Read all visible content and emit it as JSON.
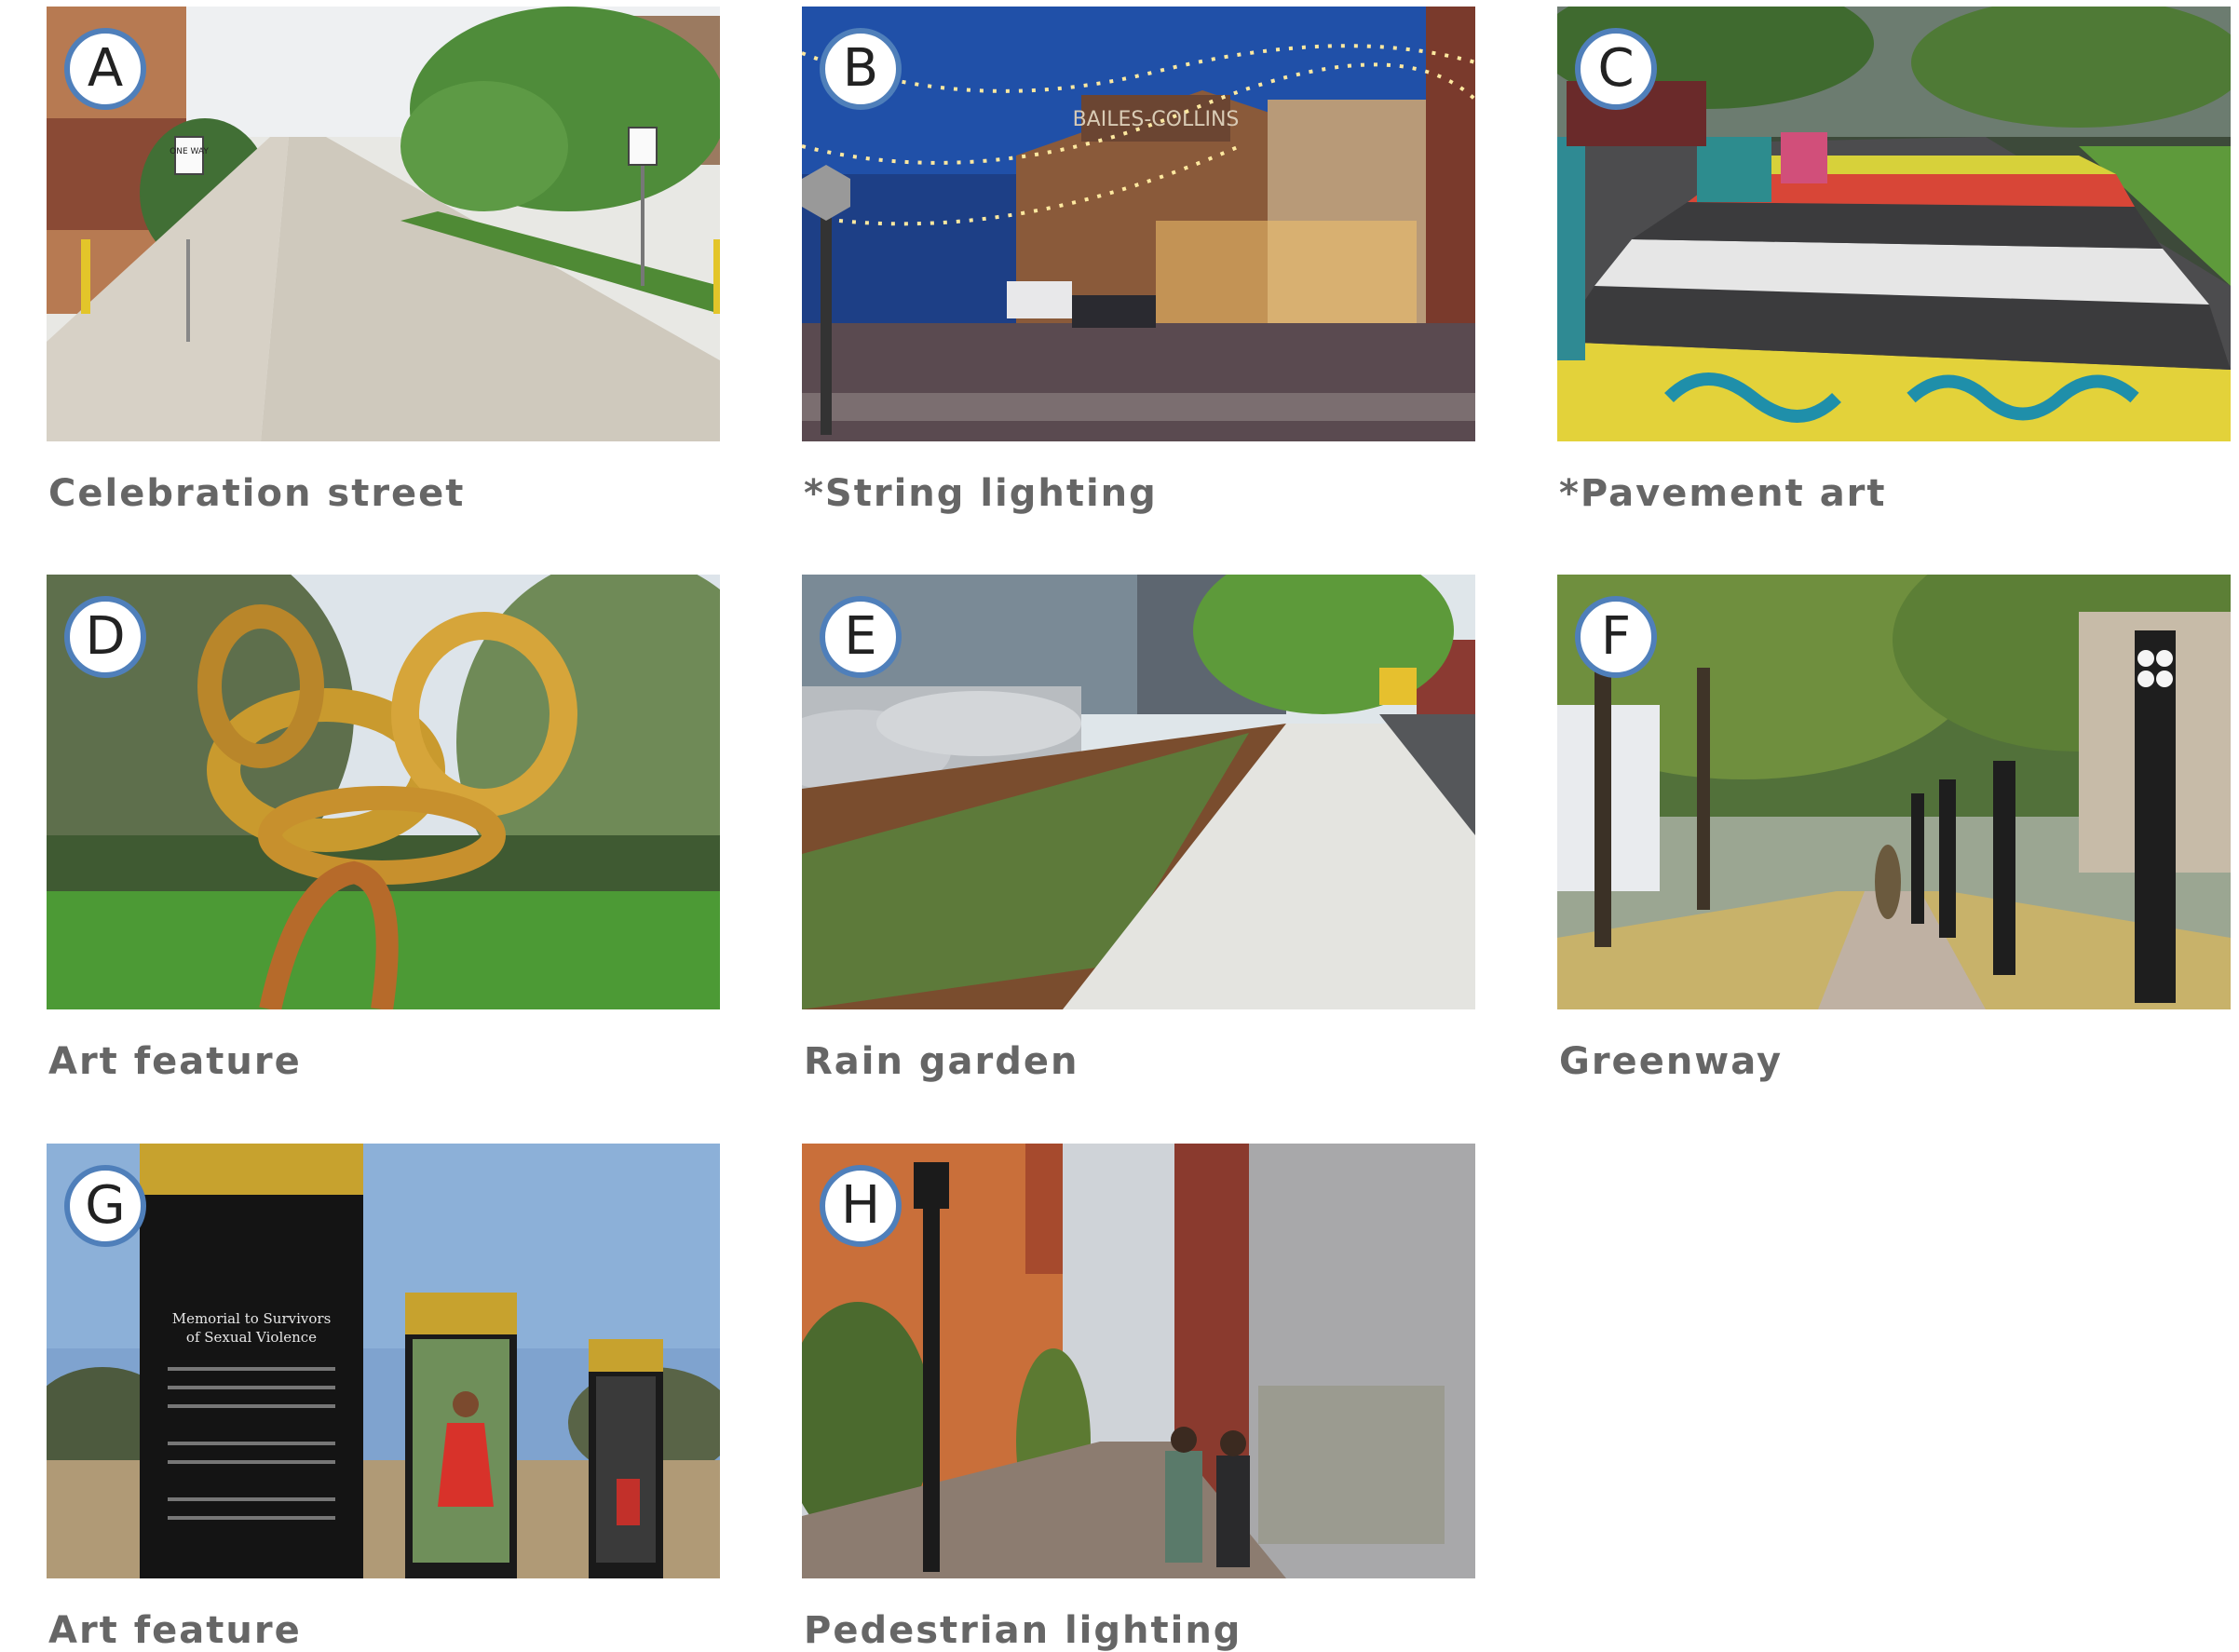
{
  "cards": [
    {
      "letter": "A",
      "caption": "Celebration street"
    },
    {
      "letter": "B",
      "caption": "*String lighting"
    },
    {
      "letter": "C",
      "caption": "*Pavement art"
    },
    {
      "letter": "D",
      "caption": "Art feature"
    },
    {
      "letter": "E",
      "caption": "Rain garden"
    },
    {
      "letter": "F",
      "caption": "Greenway"
    },
    {
      "letter": "G",
      "caption": "Art feature"
    },
    {
      "letter": "H",
      "caption": "Pedestrian lighting"
    }
  ],
  "photo_text": {
    "sign_one_way": "ONE WAY",
    "building_sign": "BAILES-COLLINS",
    "memorial_title_1": "Memorial to Survivors",
    "memorial_title_2": "of Sexual Violence"
  },
  "colors": {
    "badge_border": "#4f7fba",
    "caption": "#666666"
  }
}
